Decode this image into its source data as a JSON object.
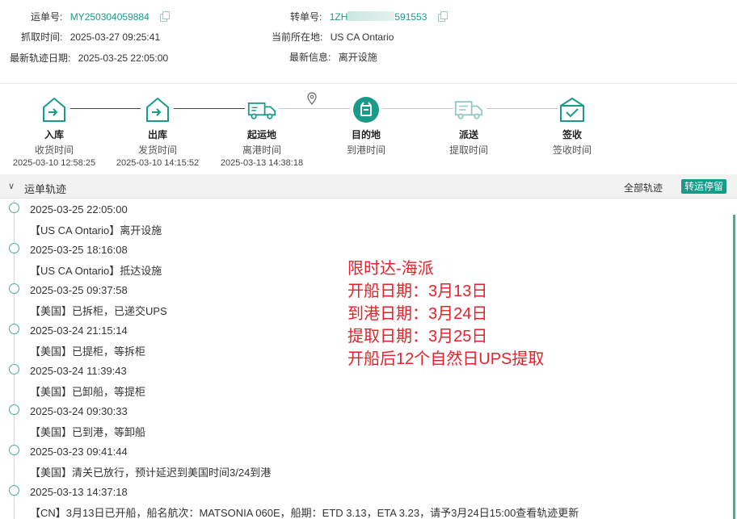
{
  "header": {
    "waybill_label": "运单号:",
    "waybill_value": "MY250304059884",
    "transfer_label": "转单号:",
    "transfer_prefix": "1ZH",
    "transfer_suffix": "591553",
    "fetch_label": "抓取时间:",
    "fetch_value": "2025-03-27 09:25:41",
    "location_label": "当前所在地:",
    "location_value": "US CA Ontario",
    "latest_date_label": "最新轨迹日期:",
    "latest_date_value": "2025-03-25 22:05:00",
    "latest_info_label": "最新信息:",
    "latest_info_value": "离开设施"
  },
  "steps": [
    {
      "title": "入库",
      "sub": "收货时间",
      "time": "2025-03-10 12:58:25",
      "icon": "warehouse-in-icon"
    },
    {
      "title": "出库",
      "sub": "发货时间",
      "time": "2025-03-10 14:15:52",
      "icon": "warehouse-out-icon"
    },
    {
      "title": "起运地",
      "sub": "离港时间",
      "time": "2025-03-13 14:38:18",
      "icon": "truck-icon"
    },
    {
      "title": "目的地",
      "sub": "到港时间",
      "time": "",
      "icon": "destination-icon"
    },
    {
      "title": "派送",
      "sub": "提取时间",
      "time": "",
      "icon": "delivery-truck-icon"
    },
    {
      "title": "签收",
      "sub": "签收时间",
      "time": "",
      "icon": "signed-box-icon"
    }
  ],
  "colors": {
    "accent": "#1a9b8a",
    "dot": "#3fb57f",
    "note": "#e8202a"
  },
  "bar": {
    "title": "运单轨迹",
    "all_label": "全部轨迹",
    "badge": "转运停留"
  },
  "events": [
    {
      "time": "2025-03-25 22:05:00",
      "desc": "【US CA Ontario】离开设施"
    },
    {
      "time": "2025-03-25 18:16:08",
      "desc": "【US CA Ontario】抵达设施"
    },
    {
      "time": "2025-03-25 09:37:58",
      "desc": "【美国】已拆柜，已递交UPS"
    },
    {
      "time": "2025-03-24 21:15:14",
      "desc": "【美国】已提柜，等拆柜"
    },
    {
      "time": "2025-03-24 11:39:43",
      "desc": "【美国】已卸船，等提柜"
    },
    {
      "time": "2025-03-24 09:30:33",
      "desc": "【美国】已到港，等卸船"
    },
    {
      "time": "2025-03-23 09:41:44",
      "desc": "【美国】清关已放行，预计延迟到美国时间3/24到港"
    },
    {
      "time": "2025-03-13 14:37:18",
      "desc": "【CN】3月13日已开船，船名航次：MATSONIA 060E，船期：ETD 3.13，ETA 3.23，请予3月24日15:00查看轨迹更新"
    }
  ],
  "note": {
    "line1": "限时达-海派",
    "line2": "开船日期：3月13日",
    "line3": "到港日期：3月24日",
    "line4": "提取日期：3月25日",
    "line5": "开船后12个自然日UPS提取"
  }
}
